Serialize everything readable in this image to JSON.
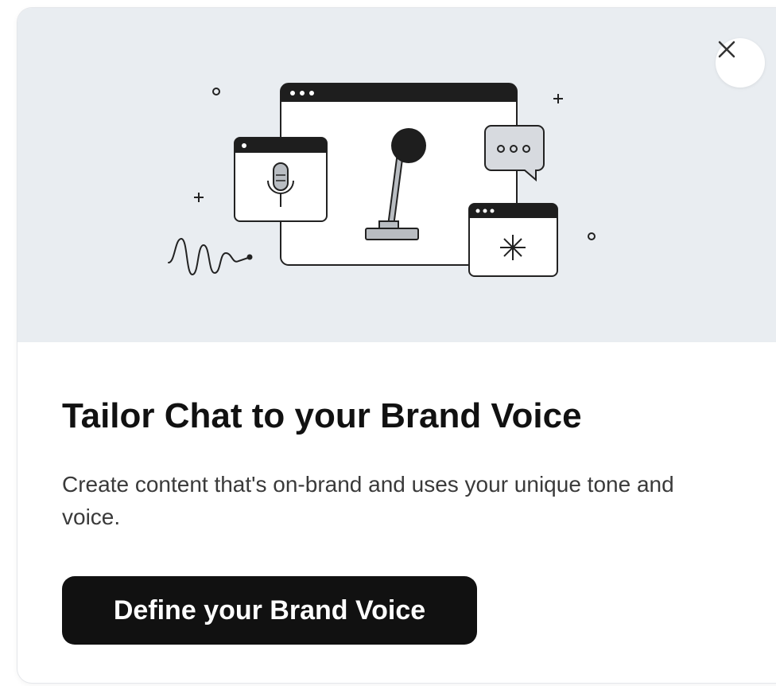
{
  "modal": {
    "title": "Tailor Chat to your Brand Voice",
    "description": "Create content that's on-brand and uses your unique tone and voice.",
    "cta_label": "Define your Brand Voice",
    "close_icon": "close-icon",
    "illustration_icons": [
      "browser-window-icon",
      "microphone-icon",
      "chat-bubble-icon",
      "sparkle-icon",
      "sound-wave-icon"
    ]
  },
  "colors": {
    "hero_background": "#e9edf1",
    "button_background": "#111111",
    "button_text": "#ffffff",
    "title_text": "#111111",
    "body_text": "#3a3a3a"
  }
}
